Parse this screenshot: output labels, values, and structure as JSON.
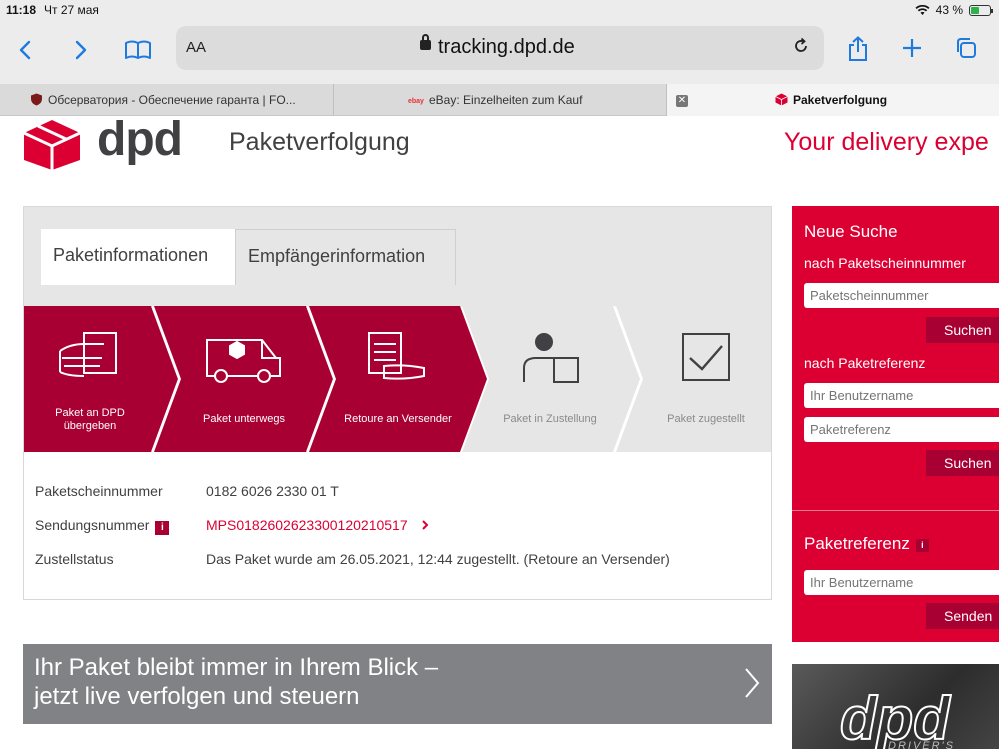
{
  "status_bar": {
    "time": "11:18",
    "date": "Чт 27 мая",
    "battery": "43 %",
    "battery_level": 0.43
  },
  "browser": {
    "text_size_label": "AA",
    "url": "tracking.dpd.de",
    "tabs": [
      {
        "label": "Обсерватория - Обеспечение гаранта | FO..."
      },
      {
        "label": "eBay: Einzelheiten zum Kauf"
      },
      {
        "label": "Paketverfolgung",
        "active": true
      }
    ]
  },
  "header": {
    "logo_text": "dpd",
    "title": "Paketverfolgung",
    "tagline": "Your delivery expe"
  },
  "tracking": {
    "tabs": [
      {
        "label": "Paketinformationen",
        "active": true
      },
      {
        "label": "Empfängerinformation",
        "active": false
      }
    ],
    "steps": [
      {
        "label": "Paket an DPD\nübergeben",
        "completed": true,
        "icon": "hand-parcel-icon"
      },
      {
        "label": "Paket unterwegs",
        "completed": true,
        "icon": "delivery-van-icon"
      },
      {
        "label": "Retoure an Versender",
        "completed": true,
        "icon": "hand-parcel-icon"
      },
      {
        "label": "Paket in Zustellung",
        "completed": false,
        "icon": "courier-icon"
      },
      {
        "label": "Paket zugestellt",
        "completed": false,
        "icon": "checkbox-icon"
      }
    ],
    "details": {
      "parcel_number_label": "Paketscheinnummer",
      "parcel_number": "0182 6026 2330 01 T",
      "shipment_number_label": "Sendungsnummer",
      "info_badge": "i",
      "shipment_number": "MPS0182602623300120210517",
      "status_label": "Zustellstatus",
      "status": "Das Paket wurde am 26.05.2021, 12:44 zugestellt. (Retoure an Versender)"
    }
  },
  "banner": {
    "line1": "Ihr Paket bleibt immer in Ihrem Blick –",
    "line2": "jetzt live verfolgen und steuern"
  },
  "sidebar": {
    "heading": "Neue Suche",
    "by_parcel_label": "nach Paketscheinnummer",
    "parcel_placeholder": "Paketscheinnummer",
    "search_button": "Suchen",
    "by_reference_label": "nach Paketreferenz",
    "username_placeholder": "Ihr Benutzername",
    "reference_placeholder": "Paketreferenz",
    "search_button_2": "Suchen",
    "reference_heading": "Paketreferenz",
    "info_badge": "i",
    "username_placeholder_2": "Ihr Benutzername",
    "send_button": "Senden"
  },
  "promo": {
    "logo": "dpd",
    "subtitle": "DRIVER'S"
  },
  "colors": {
    "brand_red": "#dc0032",
    "dark_red": "#a90034",
    "grey_text": "#414042",
    "step_inactive": "#e6e6e6"
  }
}
